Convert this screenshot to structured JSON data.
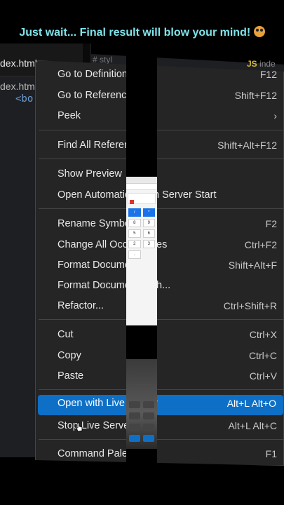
{
  "caption": {
    "text": "Just wait... Final result will blow your mind!",
    "emoji": "flushed-face-emoji"
  },
  "editor": {
    "file_tab": "dex.html",
    "file_tab2": "dex.htm",
    "code_line": "<bo",
    "mid_tab": "# styl",
    "right_tab_prefix": "JS",
    "right_tab": "inde"
  },
  "menu": {
    "items": [
      {
        "label": "Go to Definition",
        "key": "F12"
      },
      {
        "label": "Go to References",
        "key": "Shift+F12"
      },
      {
        "label": "Peek",
        "key": ""
      },
      {
        "label": "Find All References",
        "key": "Shift+Alt+F12"
      },
      {
        "label": "Show Preview",
        "key": ""
      },
      {
        "label": "Open Automatically on Server Start",
        "key": ""
      },
      {
        "label": "Rename Symbol",
        "key": "F2"
      },
      {
        "label": "Change All Occurrences",
        "key": "Ctrl+F2"
      },
      {
        "label": "Format Document",
        "key": "Shift+Alt+F"
      },
      {
        "label": "Format Document With...",
        "key": ""
      },
      {
        "label": "Refactor...",
        "key": "Ctrl+Shift+R"
      },
      {
        "label": "Cut",
        "key": "Ctrl+X"
      },
      {
        "label": "Copy",
        "key": "Ctrl+C"
      },
      {
        "label": "Paste",
        "key": "Ctrl+V"
      },
      {
        "label": "Open with Live Server",
        "key": "Alt+L Alt+O"
      },
      {
        "label": "Stop Live Server",
        "key": "Alt+L Alt+C"
      },
      {
        "label": "Command Palette...",
        "key": "F1"
      }
    ],
    "active_index": 14
  },
  "preview": {
    "keys": [
      "/",
      "*",
      "8",
      "9",
      "5",
      "6",
      "2",
      "3",
      "."
    ],
    "select_label": "Select Medium"
  },
  "colors": {
    "accent": "#0e6fc6",
    "caption": "#7fe4ea",
    "menu_bg": "#252526"
  }
}
